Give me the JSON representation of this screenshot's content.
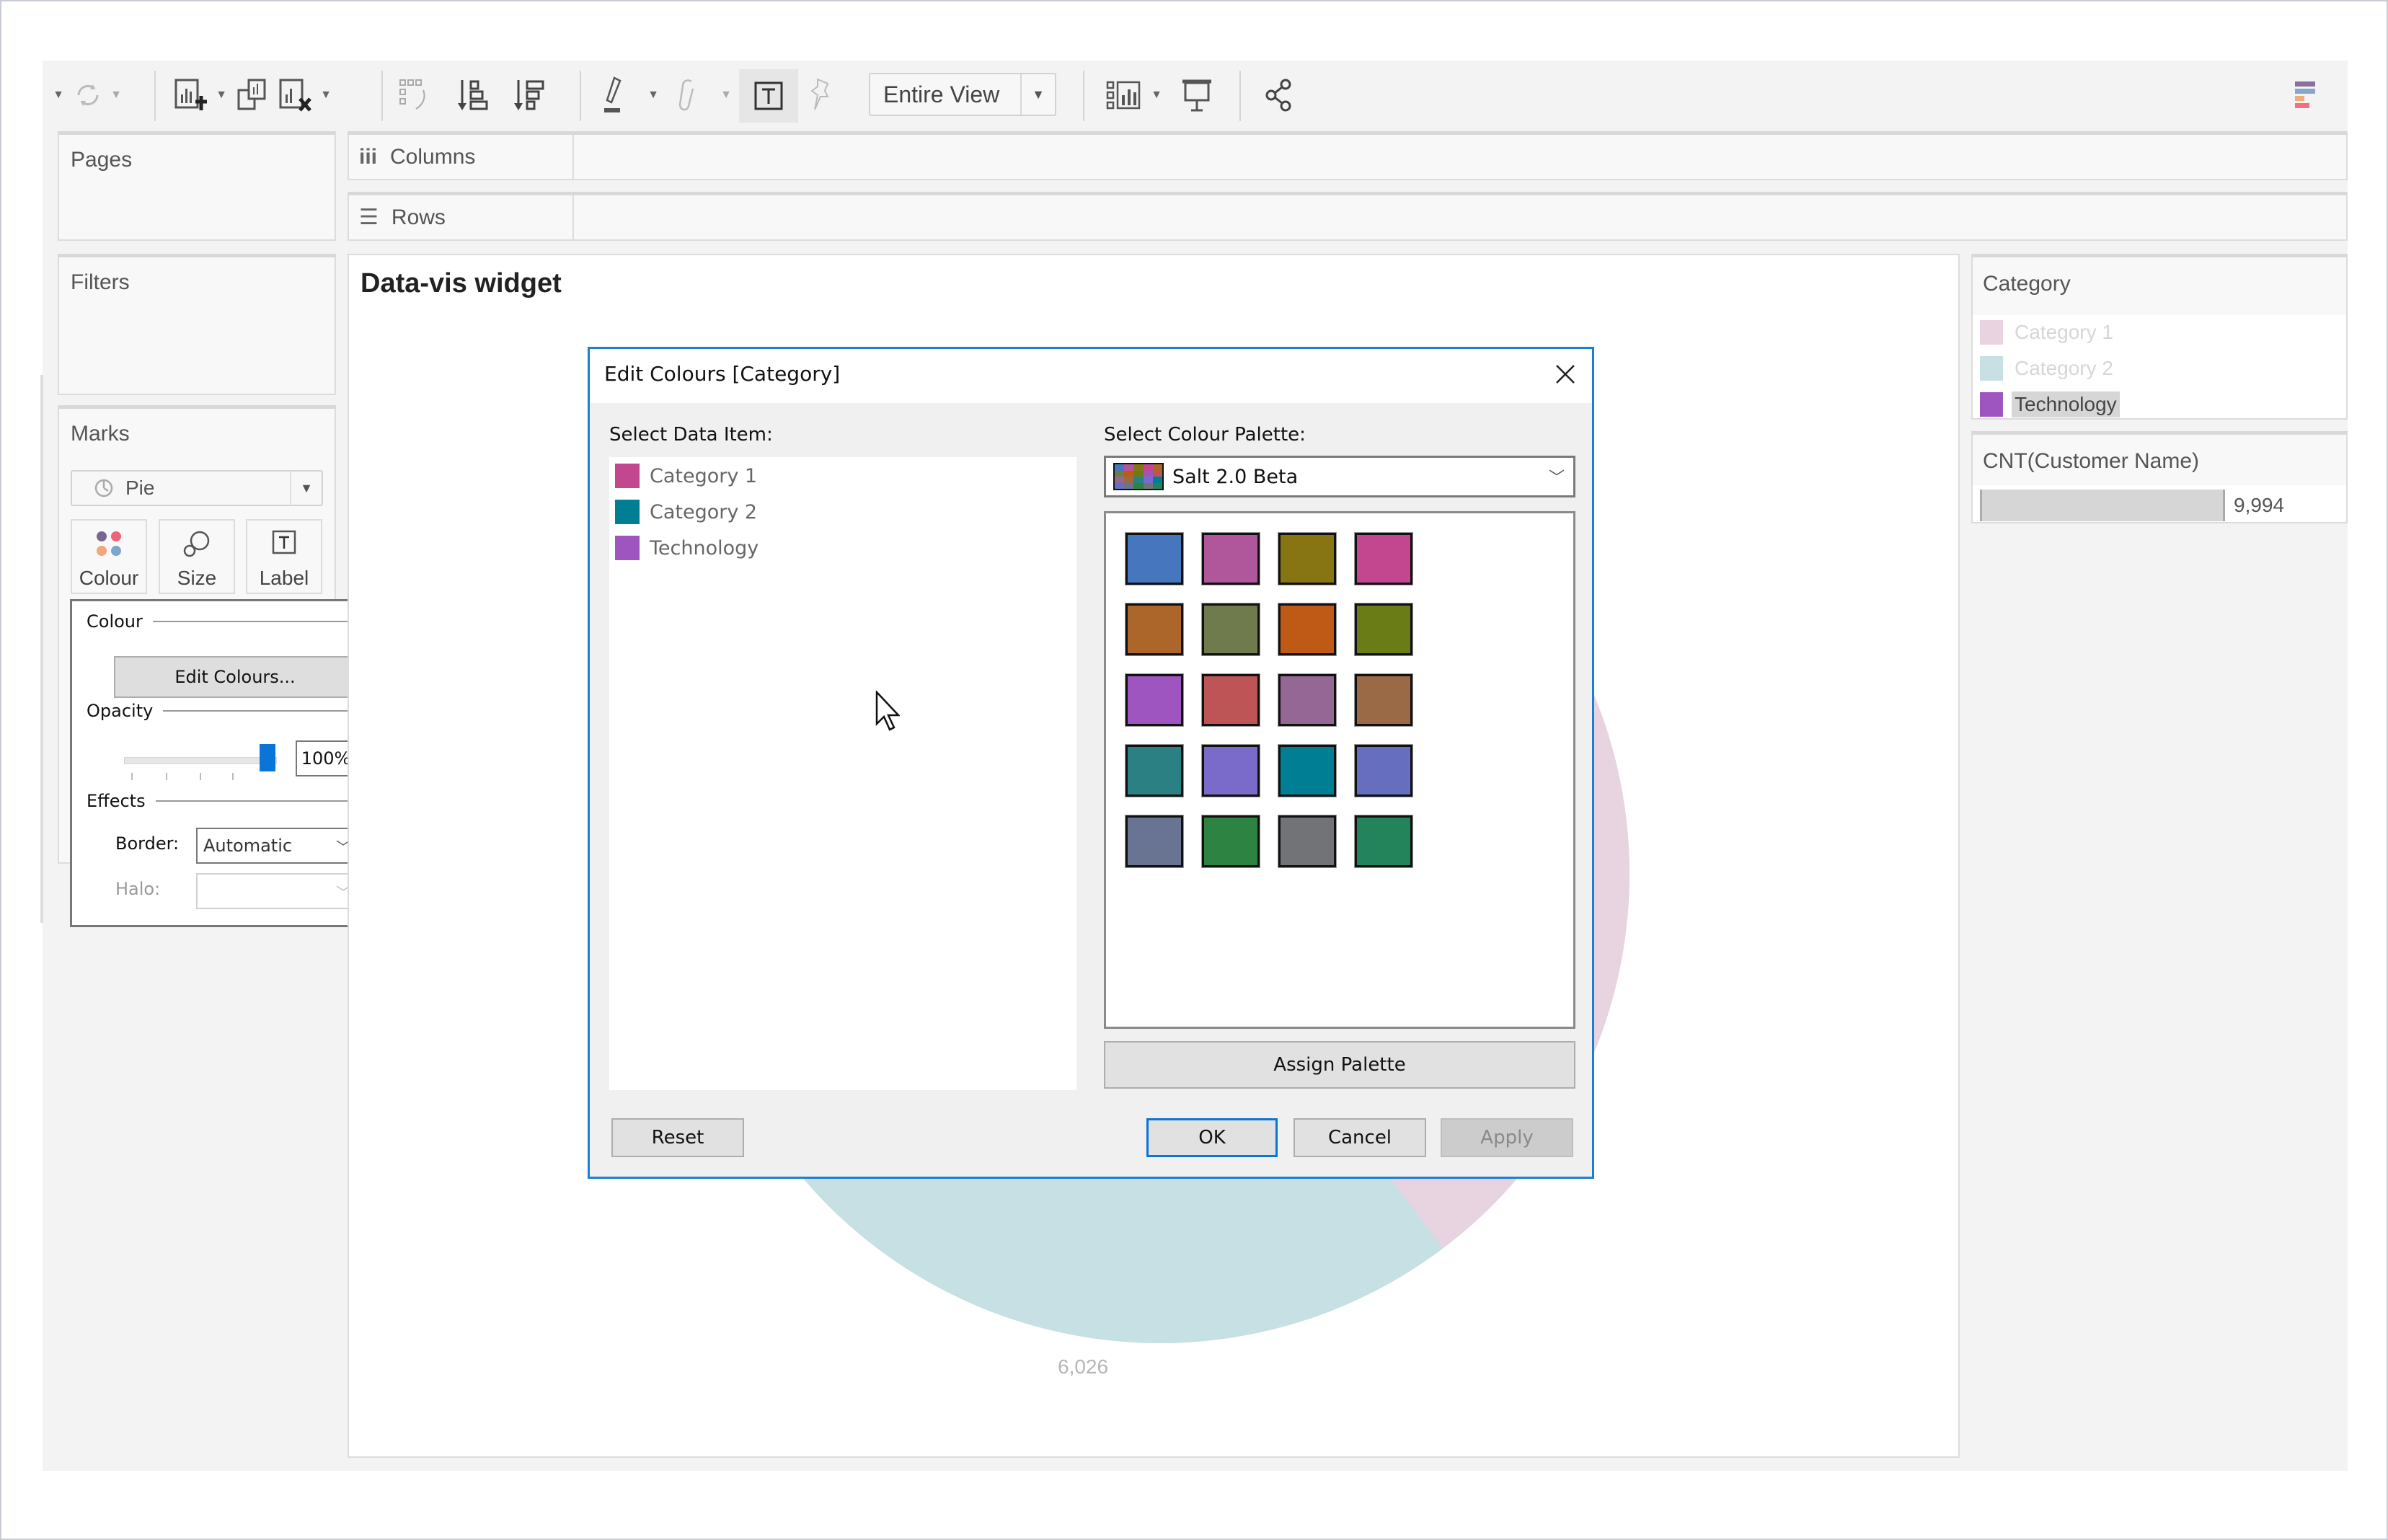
{
  "toolbar": {
    "fit_dropdown": "Entire View",
    "icons": [
      "dropdown-caret",
      "refresh",
      "new-worksheet",
      "duplicate-sheet",
      "clear-sheet",
      "swap-rows-columns",
      "sort-ascending",
      "sort-descending",
      "highlight",
      "group-members",
      "show-mark-labels",
      "fix-axes",
      "show-me",
      "presentation-mode",
      "share"
    ]
  },
  "shelves": {
    "pages": "Pages",
    "columns": "Columns",
    "rows": "Rows",
    "filters": "Filters"
  },
  "marks": {
    "title": "Marks",
    "type": "Pie",
    "cards": [
      {
        "label": "Colour"
      },
      {
        "label": "Size"
      },
      {
        "label": "Label"
      }
    ]
  },
  "colour_popup": {
    "colour_section": "Colour",
    "edit_button": "Edit Colours...",
    "opacity_section": "Opacity",
    "opacity_value": "100%",
    "opacity_fraction": 1.0,
    "effects_section": "Effects",
    "border_label": "Border:",
    "border_value": "Automatic",
    "halo_label": "Halo:",
    "halo_value": ""
  },
  "viz": {
    "title": "Data-vis widget",
    "pie_label": "6,026",
    "colors": {
      "category1": "#e8d3e1",
      "category2": "#c6e0e4"
    }
  },
  "legend": {
    "title": "Category",
    "items": [
      {
        "label": "Category 1",
        "color": "#e9d3e1",
        "dimmed": true
      },
      {
        "label": "Category 2",
        "color": "#c8e0e4",
        "dimmed": true
      },
      {
        "label": "Technology",
        "color": "#9f55c0",
        "dimmed": false,
        "highlighted": true
      }
    ]
  },
  "size_legend": {
    "title": "CNT(Customer Name)",
    "value": "9,994"
  },
  "dialog": {
    "title": "Edit Colours [Category]",
    "select_item_label": "Select Data Item:",
    "data_items": [
      {
        "label": "Category 1",
        "color": "#c2478f"
      },
      {
        "label": "Category 2",
        "color": "#007f94"
      },
      {
        "label": "Technology",
        "color": "#9f55c0"
      }
    ],
    "select_palette_label": "Select Colour Palette:",
    "palette_name": "Salt 2.0 Beta",
    "palette": [
      "#4676be",
      "#b0579c",
      "#877513",
      "#c2478f",
      "#ad6629",
      "#6f7b4d",
      "#bf5916",
      "#6a7c16",
      "#9f55c0",
      "#bd5557",
      "#956794",
      "#9a6a47",
      "#2a8083",
      "#7a6bca",
      "#007f94",
      "#656ebf",
      "#687492",
      "#2d8342",
      "#717377",
      "#23845c"
    ],
    "assign_palette": "Assign Palette",
    "reset": "Reset",
    "ok": "OK",
    "cancel": "Cancel",
    "apply": "Apply"
  }
}
